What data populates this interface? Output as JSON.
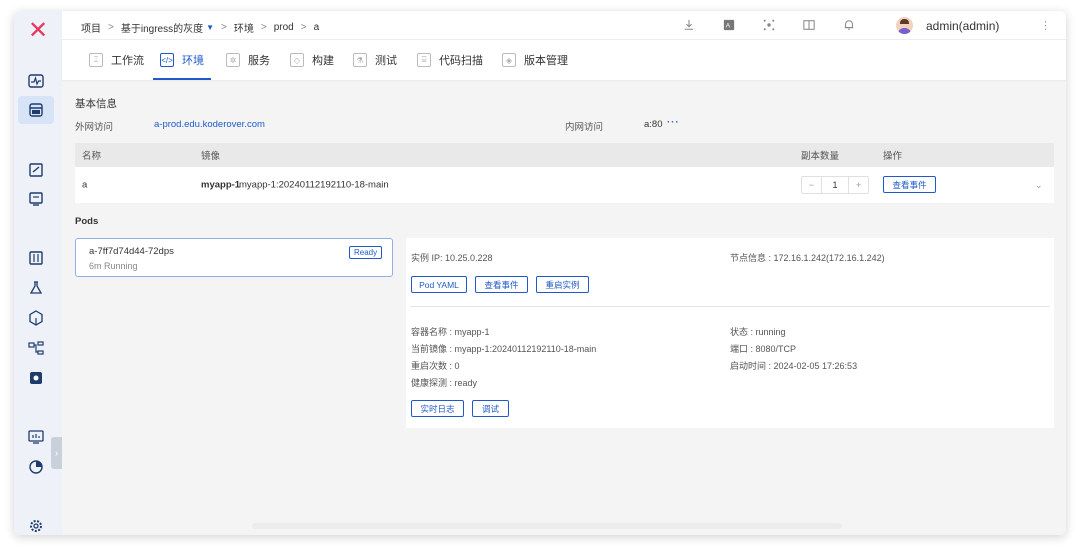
{
  "breadcrumb": {
    "project_label": "项目",
    "project_name": "基于ingress的灰度",
    "env_label": "环境",
    "env_name": "prod",
    "service_name": "a",
    "separator": ">"
  },
  "user": {
    "name": "admin(admin)"
  },
  "tabs": [
    {
      "label": "工作流"
    },
    {
      "label": "环境"
    },
    {
      "label": "服务"
    },
    {
      "label": "构建"
    },
    {
      "label": "测试"
    },
    {
      "label": "代码扫描"
    },
    {
      "label": "版本管理"
    }
  ],
  "basic_info": {
    "title": "基本信息",
    "external_label": "外网访问",
    "external_value": "a-prod.edu.koderover.com",
    "internal_label": "内网访问",
    "internal_value": "a:80",
    "internal_more": "···"
  },
  "table": {
    "headers": {
      "name": "名称",
      "image": "镜像",
      "replicas": "副本数量",
      "actions": "操作"
    },
    "row": {
      "name": "a",
      "image_name": "myapp-1",
      "image_tag": "myapp-1:20240112192110-18-main",
      "replicas": "1",
      "minus": "−",
      "plus": "+",
      "action_label": "查看事件"
    }
  },
  "pods": {
    "title": "Pods",
    "pod": {
      "name": "a-7ff7d74d44-72dps",
      "status": "6m  Running",
      "tag": "Ready"
    }
  },
  "detail": {
    "instance_ip": "实例 IP: 10.25.0.228",
    "node_info": "节点信息 : 172.16.1.242(172.16.1.242)",
    "btn_yaml": "Pod YAML",
    "btn_events": "查看事件",
    "btn_restart": "重启实例",
    "container_name": "容器名称 : myapp-1",
    "current_image": "当前镜像 : myapp-1:20240112192110-18-main",
    "restart_count": "重启次数 : 0",
    "health": "健康探测 : ready",
    "state": "状态 : running",
    "port": "端口 : 8080/TCP",
    "start_time": "启动时间 : 2024-02-05 17:26:53",
    "btn_logs": "实时日志",
    "btn_debug": "调试"
  }
}
